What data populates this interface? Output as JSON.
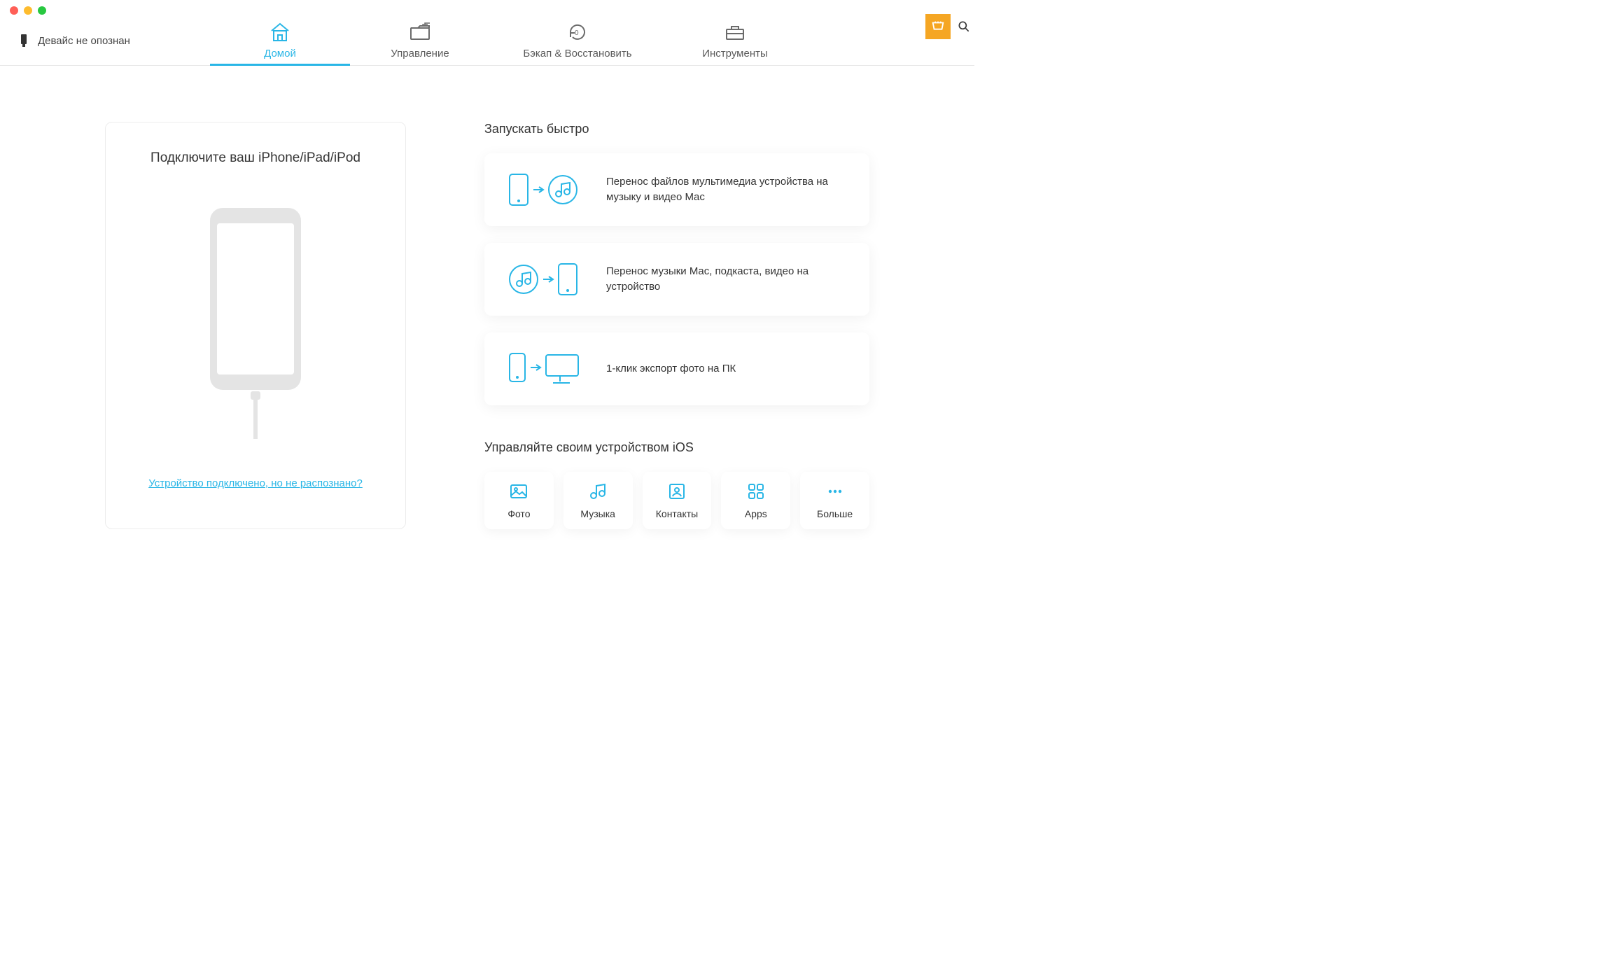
{
  "colors": {
    "accent": "#29b6e6",
    "cart": "#f5a623"
  },
  "device_status": "Девайс не опознан",
  "tabs": {
    "home": "Домой",
    "manage": "Управление",
    "backup": "Бэкап & Восстановить",
    "tools": "Инструменты"
  },
  "left": {
    "title": "Подключите ваш iPhone/iPad/iPod",
    "help_link": "Устройство подключено, но не распознано?"
  },
  "quick": {
    "heading": "Запускать быстро",
    "items": [
      "Перенос файлов мультимедиа устройства на музыку и видео Mac",
      "Перенос музыки Mac, подкаста, видео на устройство",
      "1-клик экспорт фото на ПК"
    ]
  },
  "manage": {
    "heading": "Управляйте своим устройством iOS",
    "tiles": {
      "photo": "Фото",
      "music": "Музыка",
      "contacts": "Контакты",
      "apps": "Apps",
      "more": "Больше"
    }
  }
}
